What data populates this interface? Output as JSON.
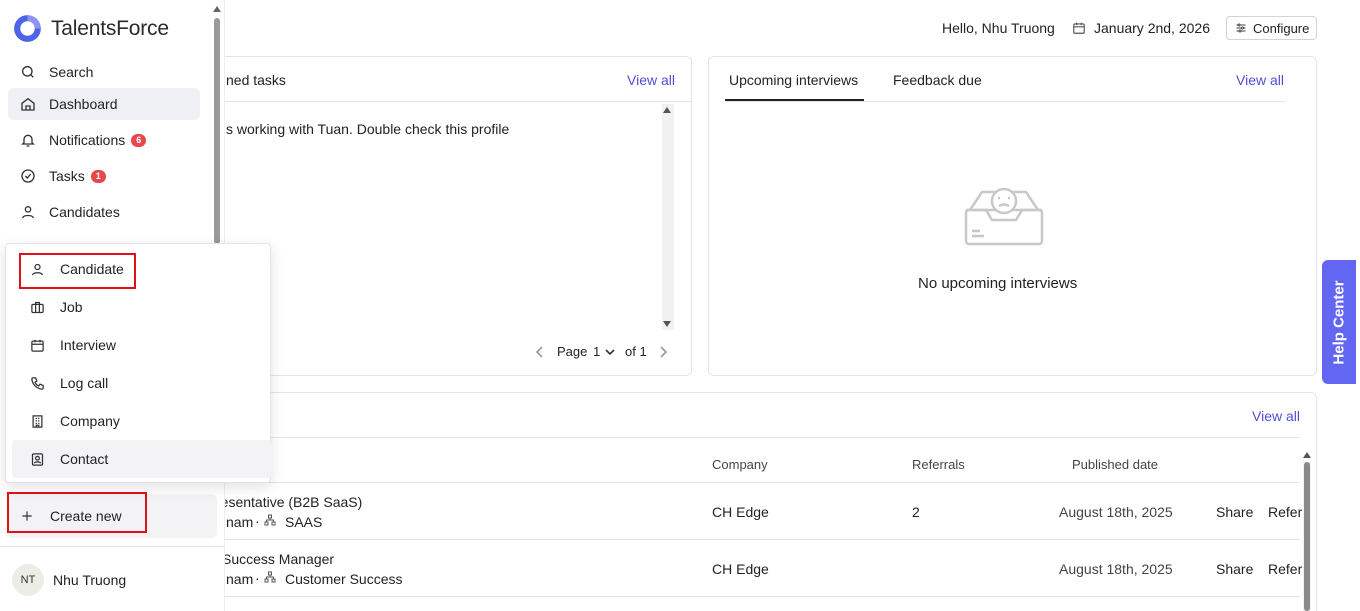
{
  "app": {
    "name": "TalentsForce"
  },
  "header": {
    "greeting": "Hello, Nhu Truong",
    "date": "January 2nd, 2026",
    "configure_label": "Configure"
  },
  "sidebar": {
    "items": [
      {
        "label": "Search"
      },
      {
        "label": "Dashboard"
      },
      {
        "label": "Notifications",
        "badge": "6"
      },
      {
        "label": "Tasks",
        "badge": "1"
      },
      {
        "label": "Candidates"
      }
    ],
    "create_new_label": "Create new",
    "user": {
      "initials": "NT",
      "name": "Nhu Truong"
    }
  },
  "create_menu": {
    "items": [
      {
        "label": "Candidate",
        "icon": "user-icon"
      },
      {
        "label": "Job",
        "icon": "briefcase-icon"
      },
      {
        "label": "Interview",
        "icon": "calendar-icon"
      },
      {
        "label": "Log call",
        "icon": "phone-icon"
      },
      {
        "label": "Company",
        "icon": "building-icon"
      },
      {
        "label": "Contact",
        "icon": "contact-card-icon"
      }
    ]
  },
  "tasks_panel": {
    "title_fragment": "ned tasks",
    "view_all": "View all",
    "task_text": "s working with Tuan. Double check this profile",
    "pagination": {
      "page_label": "Page",
      "page": "1",
      "of_label": "of 1"
    }
  },
  "interviews_panel": {
    "tabs": [
      {
        "label": "Upcoming interviews"
      },
      {
        "label": "Feedback due"
      }
    ],
    "view_all": "View all",
    "empty_text": "No upcoming interviews"
  },
  "jobs_panel": {
    "view_all": "View all",
    "columns": {
      "company": "Company",
      "referrals": "Referrals",
      "published": "Published date"
    },
    "rows": [
      {
        "title": "resentative (B2B SaaS)",
        "location": "nam",
        "department": "SAAS",
        "company": "CH Edge",
        "referrals": "2",
        "published": "August 18th, 2025",
        "share": "Share",
        "refer": "Refer"
      },
      {
        "title": " Success Manager",
        "location": "nam",
        "department": "Customer Success",
        "company": "CH Edge",
        "referrals": "",
        "published": "August 18th, 2025",
        "share": "Share",
        "refer": "Refer"
      }
    ]
  },
  "help_center": {
    "label": "Help Center"
  },
  "colors": {
    "accent": "#5b5bd6",
    "highlight_box": "#e0101a",
    "badge": "#e5484d"
  }
}
